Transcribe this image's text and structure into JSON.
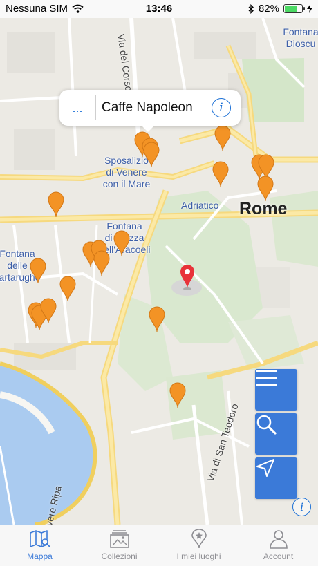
{
  "status_bar": {
    "carrier": "Nessuna SIM",
    "time": "13:46",
    "battery": "82%",
    "battery_level": 0.82
  },
  "map": {
    "selected_place": {
      "title": "Caffe Napoleon",
      "more_label": "..."
    },
    "city_label": "Rome",
    "place_labels": {
      "sposalizio": "Sposalizio\ndi Venere\ncon il Mare",
      "fontana_piazza": "Fontana\ndi Piazza\ndell'Aracoeli",
      "fontana_tartarughe": "Fontana\ndelle\nTartarughe",
      "fontana_dioscuri": "Fontana\nDioscu",
      "adriatico": "Adriatico"
    },
    "street_labels": {
      "corso": "Via del Corso",
      "san_teodoro": "Via di San Teodoro",
      "ripa": "vere Ripa"
    },
    "pin_color": "#f39325",
    "selected_pin_color": "#e8333a"
  },
  "controls": {
    "menu_icon": "hamburger-icon",
    "search_icon": "search-icon",
    "locate_icon": "location-arrow-icon",
    "accent": "#3b7ad8"
  },
  "tabs": [
    {
      "label": "Mappa",
      "icon": "map-icon",
      "active": true
    },
    {
      "label": "Collezioni",
      "icon": "collections-icon",
      "active": false
    },
    {
      "label": "I miei luoghi",
      "icon": "place-pin-icon",
      "active": false
    },
    {
      "label": "Account",
      "icon": "user-icon",
      "active": false
    }
  ]
}
